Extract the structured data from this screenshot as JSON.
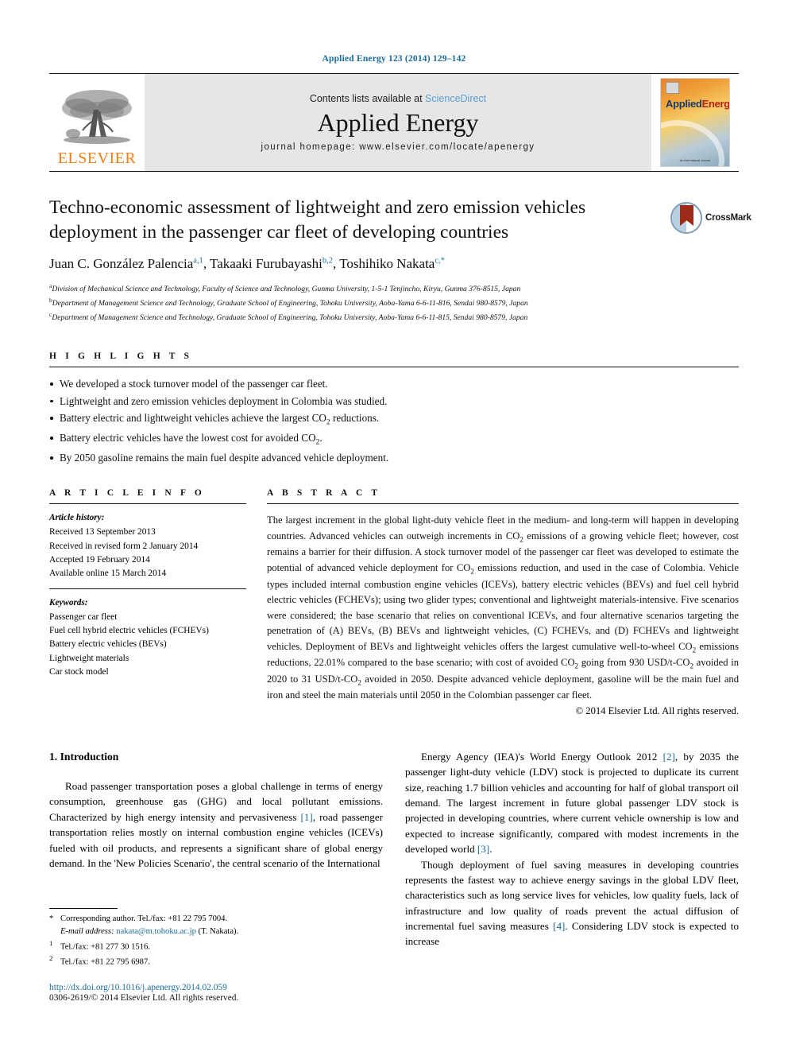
{
  "running_head": "Applied Energy 123 (2014) 129–142",
  "masthead": {
    "publisher_name": "ELSEVIER",
    "contents_prefix": "Contents lists available at ",
    "contents_link": "ScienceDirect",
    "journal_name": "Applied Energy",
    "homepage": "journal homepage: www.elsevier.com/locate/apenergy",
    "cover_title_a": "Applied",
    "cover_title_b": "Energy",
    "cover_footer": "An International Journal"
  },
  "article": {
    "title": "Techno-economic assessment of lightweight and zero emission vehicles deployment in the passenger car fleet of developing countries",
    "crossmark_label": "CrossMark",
    "authors": [
      {
        "name": "Juan C. González Palencia",
        "sup": "a,1",
        "sep": ", "
      },
      {
        "name": "Takaaki Furubayashi",
        "sup": "b,2",
        "sep": ", "
      },
      {
        "name": "Toshihiko Nakata",
        "sup": "c,*",
        "sep": ""
      }
    ],
    "affiliations": [
      {
        "marker": "a",
        "text": "Division of Mechanical Science and Technology, Faculty of Science and Technology, Gunma University, 1-5-1 Tenjincho, Kiryu, Gunma 376-8515, Japan"
      },
      {
        "marker": "b",
        "text": "Department of Management Science and Technology, Graduate School of Engineering, Tohoku University, Aoba-Yama 6-6-11-816, Sendai 980-8579, Japan"
      },
      {
        "marker": "c",
        "text": "Department of Management Science and Technology, Graduate School of Engineering, Tohoku University, Aoba-Yama 6-6-11-815, Sendai 980-8579, Japan"
      }
    ]
  },
  "highlights": {
    "heading": "H I G H L I G H T S",
    "items": [
      "We developed a stock turnover model of the passenger car fleet.",
      "Lightweight and zero emission vehicles deployment in Colombia was studied.",
      "Battery electric and lightweight vehicles achieve the largest CO2 reductions.",
      "Battery electric vehicles have the lowest cost for avoided CO2.",
      "By 2050 gasoline remains the main fuel despite advanced vehicle deployment."
    ]
  },
  "article_info": {
    "heading": "A R T I C L E    I N F O",
    "history_title": "Article history:",
    "history": [
      "Received 13 September 2013",
      "Received in revised form 2 January 2014",
      "Accepted 19 February 2014",
      "Available online 15 March 2014"
    ],
    "keywords_title": "Keywords:",
    "keywords": [
      "Passenger car fleet",
      "Fuel cell hybrid electric vehicles (FCHEVs)",
      "Battery electric vehicles (BEVs)",
      "Lightweight materials",
      "Car stock model"
    ]
  },
  "abstract": {
    "heading": "A B S T R A C T",
    "text": "The largest increment in the global light-duty vehicle fleet in the medium- and long-term will happen in developing countries. Advanced vehicles can outweigh increments in CO2 emissions of a growing vehicle fleet; however, cost remains a barrier for their diffusion. A stock turnover model of the passenger car fleet was developed to estimate the potential of advanced vehicle deployment for CO2 emissions reduction, and used in the case of Colombia. Vehicle types included internal combustion engine vehicles (ICEVs), battery electric vehicles (BEVs) and fuel cell hybrid electric vehicles (FCHEVs); using two glider types; conventional and lightweight materials-intensive. Five scenarios were considered; the base scenario that relies on conventional ICEVs, and four alternative scenarios targeting the penetration of (A) BEVs, (B) BEVs and lightweight vehicles, (C) FCHEVs, and (D) FCHEVs and lightweight vehicles. Deployment of BEVs and lightweight vehicles offers the largest cumulative well-to-wheel CO2 emissions reductions, 22.01% compared to the base scenario; with cost of avoided CO2 going from 930 USD/t-CO2 avoided in 2020 to 31 USD/t-CO2 avoided in 2050. Despite advanced vehicle deployment, gasoline will be the main fuel and iron and steel the main materials until 2050 in the Colombian passenger car fleet.",
    "copyright": "© 2014 Elsevier Ltd. All rights reserved."
  },
  "introduction": {
    "heading": "1. Introduction",
    "left_paragraph": "Road passenger transportation poses a global challenge in terms of energy consumption, greenhouse gas (GHG) and local pollutant emissions. Characterized by high energy intensity and pervasiveness [1], road passenger transportation relies mostly on internal combustion engine vehicles (ICEVs) fueled with oil products, and represents a significant share of global energy demand. In the 'New Policies Scenario', the central scenario of the International",
    "right_paragraph_1": "Energy Agency (IEA)'s World Energy Outlook 2012 [2], by 2035 the passenger light-duty vehicle (LDV) stock is projected to duplicate its current size, reaching 1.7 billion vehicles and accounting for half of global transport oil demand. The largest increment in future global passenger LDV stock is projected in developing countries, where current vehicle ownership is low and expected to increase significantly, compared with modest increments in the developed world [3].",
    "right_paragraph_2": "Though deployment of fuel saving measures in developing countries represents the fastest way to achieve energy savings in the global LDV fleet, characteristics such as long service lives for vehicles, low quality fuels, lack of infrastructure and low quality of roads prevent the actual diffusion of incremental fuel saving measures [4]. Considering LDV stock is expected to increase"
  },
  "footnotes": {
    "corresponding": "Corresponding author. Tel./fax: +81 22 795 7004.",
    "email_label": "E-mail address:",
    "email": "nakata@m.tohoku.ac.jp",
    "email_suffix": "(T. Nakata).",
    "note1": "Tel./fax: +81 277 30 1516.",
    "note2": "Tel./fax: +81 22 795 6987.",
    "doi": "http://dx.doi.org/10.1016/j.apenergy.2014.02.059",
    "issn": "0306-2619/© 2014 Elsevier Ltd. All rights reserved."
  },
  "colors": {
    "link": "#1a6b9a",
    "elsevier_orange": "#F07F13",
    "band_gray": "#e6e6e6"
  }
}
